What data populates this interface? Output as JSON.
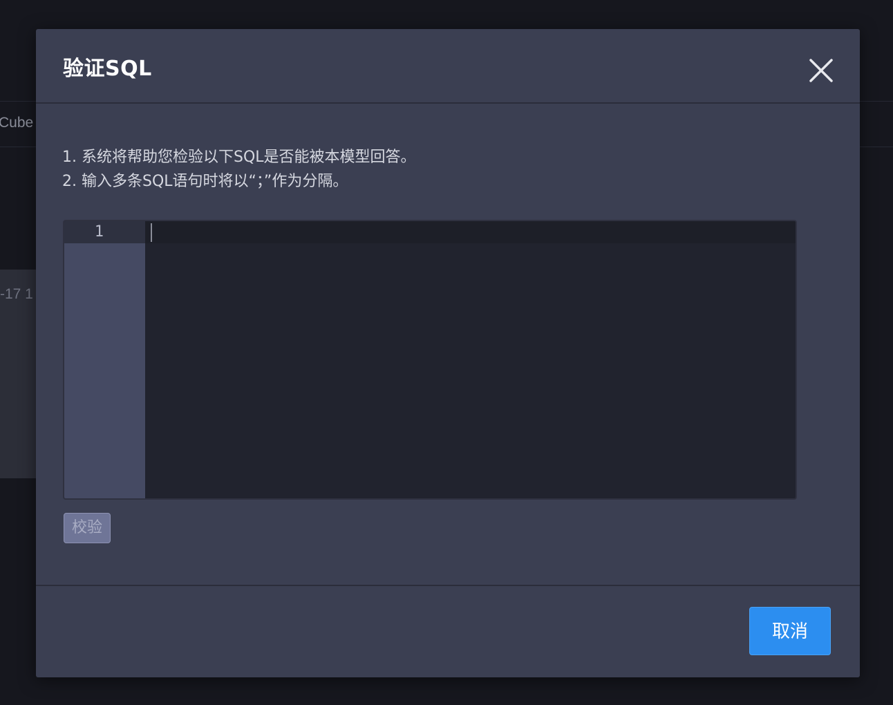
{
  "background": {
    "tab_fragment": "Cube",
    "date_fragment": "-17 1"
  },
  "dialog": {
    "title": "验证SQL",
    "close_icon": "close-icon",
    "instructions": [
      "1. 系统将帮助您检验以下SQL是否能被本模型回答。",
      "2. 输入多条SQL语句时将以“；”作为分隔。"
    ],
    "editor": {
      "line_numbers": [
        "1"
      ],
      "content": ""
    },
    "verify_button": "校验",
    "cancel_button": "取消"
  },
  "colors": {
    "modal_bg": "#3b3f52",
    "editor_bg": "#21232e",
    "gutter_bg": "#454a63",
    "primary": "#2c8ef0"
  }
}
